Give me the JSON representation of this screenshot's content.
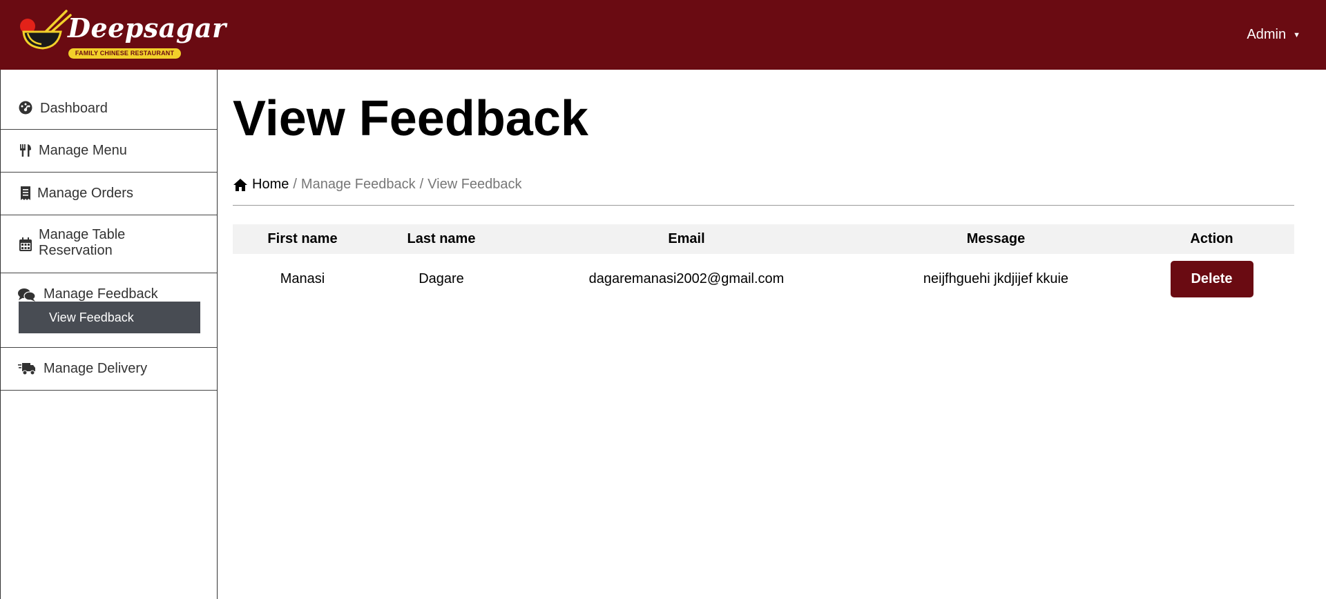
{
  "header": {
    "brand_name": "Deepsagar",
    "brand_tagline": "FAMILY CHINESE RESTAURANT",
    "user_menu_label": "Admin",
    "colors": {
      "brand": "#6a0b12",
      "tagline_bg": "#f2d02a",
      "submenu_bg": "#484c53"
    }
  },
  "sidebar": {
    "items": [
      {
        "label": "Dashboard",
        "icon": "dashboard-gauge-icon"
      },
      {
        "label": "Manage Menu",
        "icon": "utensils-icon"
      },
      {
        "label": "Manage Orders",
        "icon": "receipt-icon"
      },
      {
        "label": "Manage Table Reservation",
        "icon": "calendar-icon"
      },
      {
        "label": "Manage Feedback",
        "icon": "comments-icon",
        "expanded": true,
        "sub_items": [
          {
            "label": "View Feedback",
            "active": true
          }
        ]
      },
      {
        "label": "Manage Delivery",
        "icon": "delivery-truck-icon"
      }
    ]
  },
  "main": {
    "title": "View Feedback",
    "breadcrumb": {
      "home": "Home",
      "separator": "/",
      "items": [
        "Manage Feedback",
        "View Feedback"
      ]
    },
    "table": {
      "columns": [
        "First name",
        "Last name",
        "Email",
        "Message",
        "Action"
      ],
      "rows": [
        {
          "first_name": "Manasi",
          "last_name": "Dagare",
          "email": "dagaremanasi2002@gmail.com",
          "message": "neijfhguehi jkdjijef kkuie",
          "action_label": "Delete"
        }
      ]
    }
  }
}
